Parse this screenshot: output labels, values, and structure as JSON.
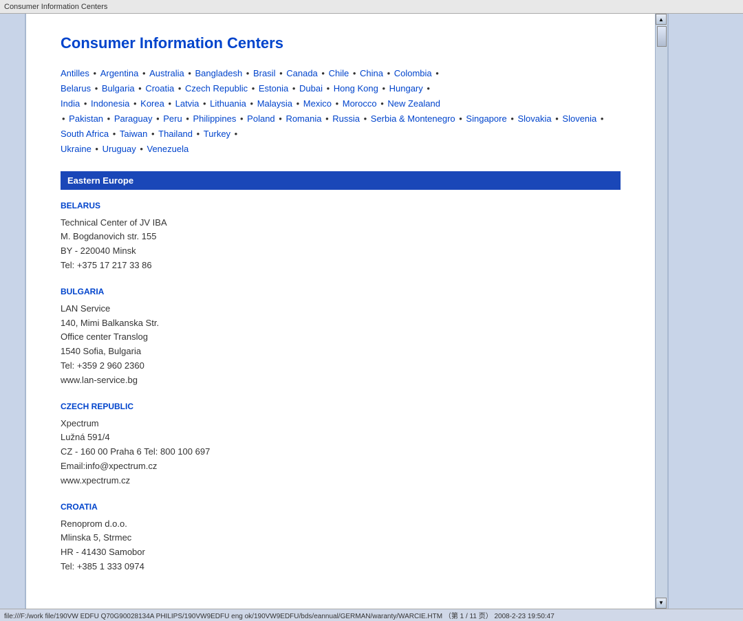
{
  "titleBar": {
    "text": "Consumer Information Centers"
  },
  "pageTitle": "Consumer Information Centers",
  "links": [
    "Antilles",
    "Argentina",
    "Australia",
    "Bangladesh",
    "Brasil",
    "Canada",
    "Chile",
    "China",
    "Colombia",
    "Belarus",
    "Bulgaria",
    "Croatia",
    "Czech Republic",
    "Estonia",
    "Dubai",
    "Hong Kong",
    "Hungary",
    "India",
    "Indonesia",
    "Korea",
    "Latvia",
    "Lithuania",
    "Malaysia",
    "Mexico",
    "Morocco",
    "New Zealand",
    "Pakistan",
    "Paraguay",
    "Peru",
    "Philippines",
    "Poland",
    "Romania",
    "Russia",
    "Serbia & Montenegro",
    "Singapore",
    "Slovakia",
    "Slovenia",
    "South Africa",
    "Taiwan",
    "Thailand",
    "Turkey",
    "Ukraine",
    "Uruguay",
    "Venezuela"
  ],
  "sectionHeader": "Eastern Europe",
  "countries": [
    {
      "name": "BELARUS",
      "info": [
        "Technical Center of JV IBA",
        "M. Bogdanovich str. 155",
        "BY - 220040 Minsk",
        "Tel: +375 17 217 33 86"
      ]
    },
    {
      "name": "BULGARIA",
      "info": [
        "LAN Service",
        "140, Mimi Balkanska Str.",
        "Office center Translog",
        "1540 Sofia, Bulgaria",
        "Tel: +359 2 960 2360",
        "www.lan-service.bg"
      ]
    },
    {
      "name": "CZECH REPUBLIC",
      "info": [
        "Xpectrum",
        "Lužná 591/4",
        "CZ - 160 00 Praha 6 Tel: 800 100 697",
        "Email:info@xpectrum.cz",
        "www.xpectrum.cz"
      ]
    },
    {
      "name": "CROATIA",
      "info": [
        "Renoprom d.o.o.",
        "Mlinska 5, Strmec",
        "HR - 41430 Samobor",
        "Tel: +385 1 333 0974"
      ]
    }
  ],
  "statusBar": {
    "text": "file:///F:/work file/190VW EDFU Q70G90028134A PHILIPS/190VW9EDFU eng ok/190VW9EDFU/bds/eannual/GERMAN/waranty/WARCIE.HTM （第 1 / 11 页） 2008-2-23 19:50:47"
  }
}
